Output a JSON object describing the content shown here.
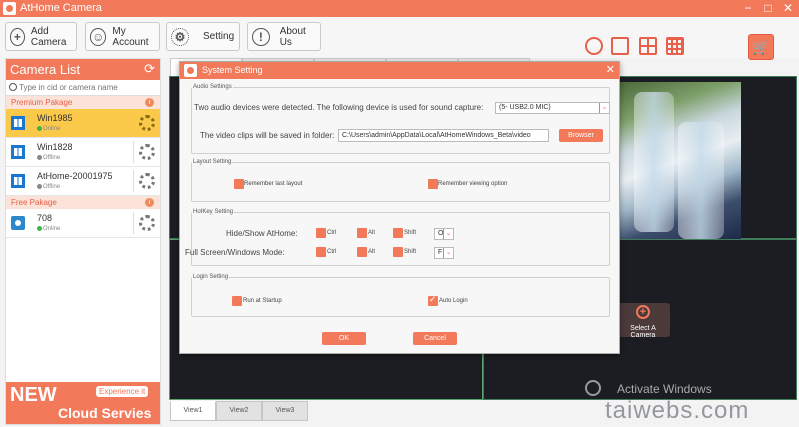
{
  "app": {
    "title": "AtHome Camera",
    "minimize": "−",
    "maximize": "□",
    "close": "✕"
  },
  "toolbar": {
    "add_camera": "Add Camera",
    "my_account": "My Account",
    "setting": "Setting",
    "about_us": "About Us"
  },
  "sidebar": {
    "header": "Camera List",
    "search_placeholder": "Type in cid or camera name",
    "groups": [
      {
        "label": "Premium Pakage",
        "cameras": [
          {
            "name": "Win1985",
            "status": "Online"
          },
          {
            "name": "Win1828",
            "status": "Offline"
          },
          {
            "name": "AtHome-20001975",
            "status": "Offline"
          }
        ]
      },
      {
        "label": "Free Pakage",
        "cameras": [
          {
            "name": "708",
            "status": "Online"
          }
        ]
      }
    ],
    "promo": {
      "new": "NEW",
      "experience": "Experience it",
      "cloud": "Cloud Servies"
    }
  },
  "main": {
    "tab_stub": "R",
    "select_camera": "Select A Camera",
    "bottom_tabs": [
      "View1",
      "View2",
      "View3"
    ],
    "activate": "Activate Windows",
    "watermark": "taiwebs.com"
  },
  "dialog": {
    "title": "System Setting",
    "audio": {
      "legend": "Audio Settings",
      "detected_text": "Two audio devices were detected.  The following device is used for sound capture:",
      "device": "(5- USB2.0 MIC)",
      "save_text": "The video clips will be saved in folder:",
      "path": "C:\\Users\\admin\\AppData\\Local\\AtHomeWindows_Beta\\video",
      "browser": "Browser"
    },
    "layout": {
      "legend": "Layout Setting",
      "remember_last": "Remember last layout",
      "remember_view": "Remember viewing option"
    },
    "hotkey": {
      "legend": "HotKey Setting",
      "hide_show": "Hide/Show AtHome:",
      "fullscreen": "Full Screen/Windows Mode:",
      "ctrl": "Ctrl",
      "alt": "Alt",
      "shift": "Shift",
      "hide_key": "O",
      "full_key": "F"
    },
    "login": {
      "legend": "Login Setting",
      "run_startup": "Run at Startup",
      "auto_login": "Auto Login"
    },
    "ok": "OK",
    "cancel": "Cancel"
  }
}
